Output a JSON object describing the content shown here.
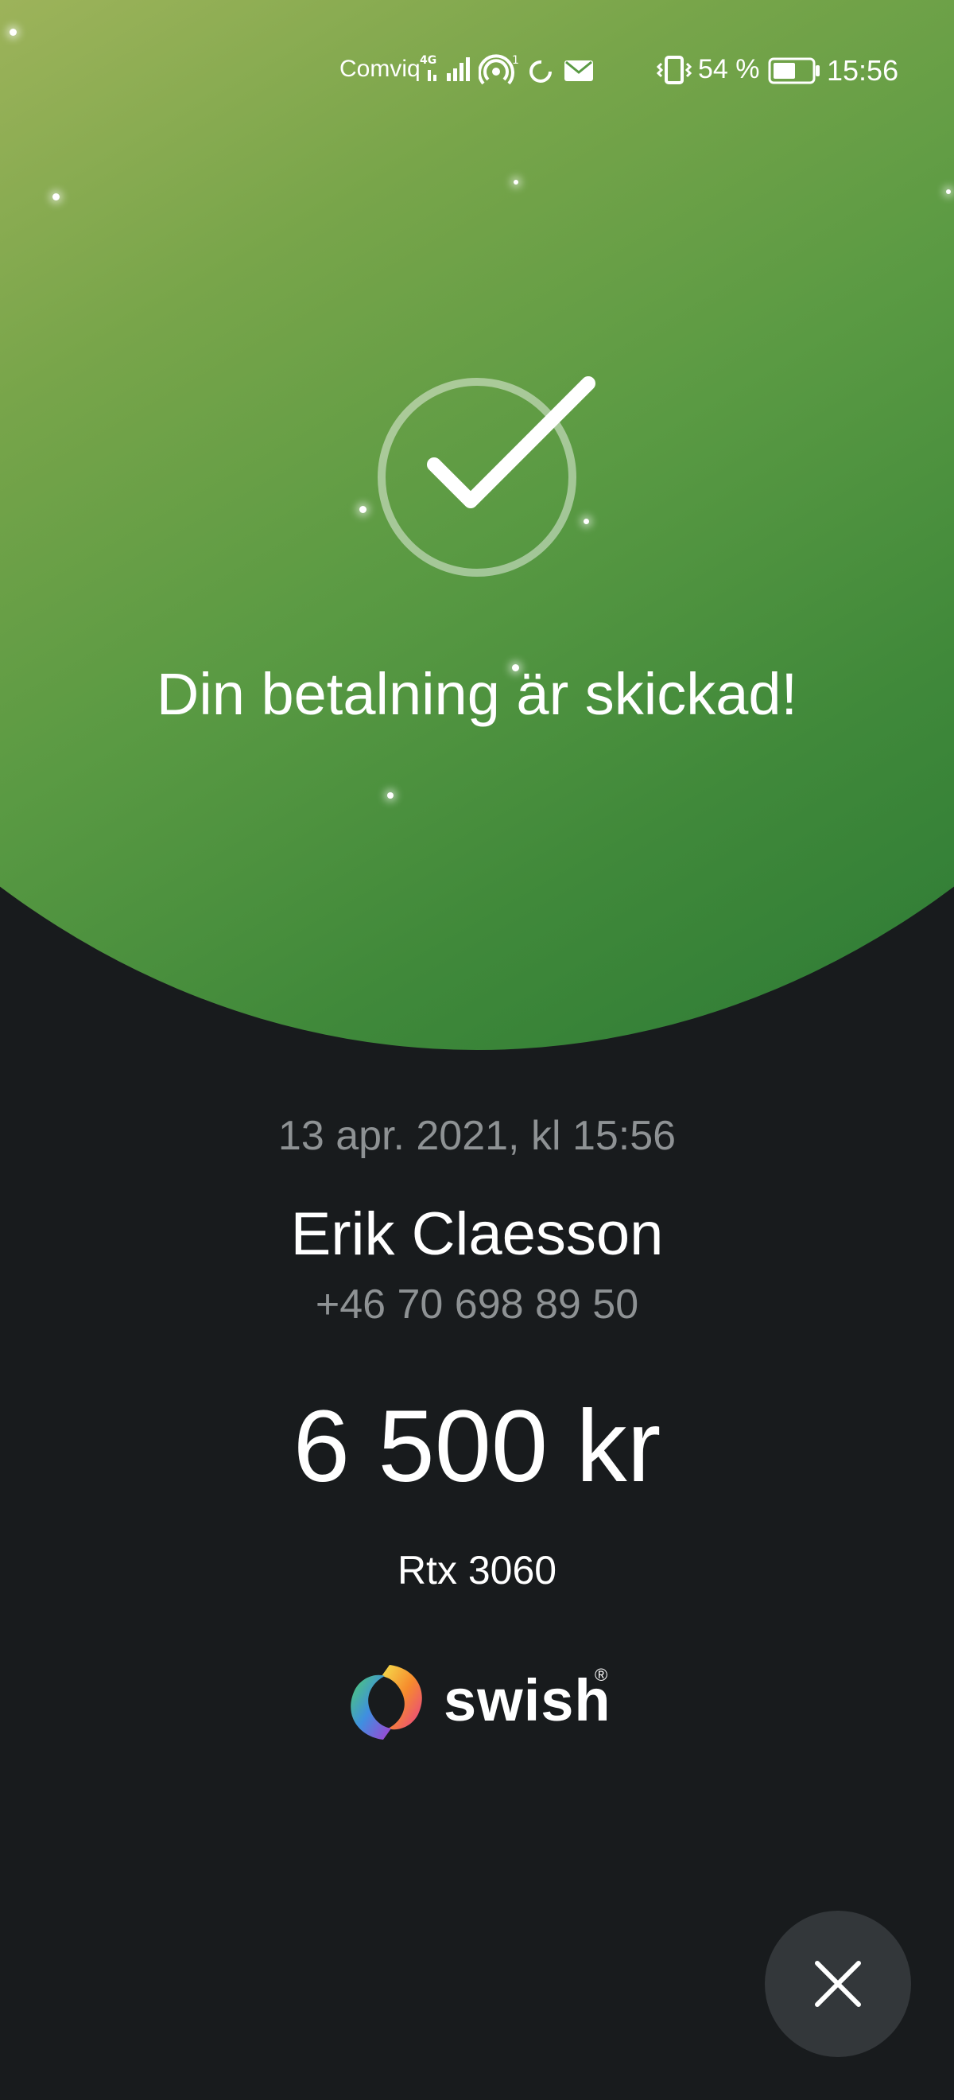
{
  "status_bar": {
    "carrier": "Comviq",
    "network": "4G",
    "battery_percent": "54 %",
    "time": "15:56"
  },
  "confirmation": {
    "headline": "Din betalning är skickad!"
  },
  "payment": {
    "datetime": "13 apr. 2021, kl 15:56",
    "recipient_name": "Erik Claesson",
    "recipient_phone": "+46 70 698 89 50",
    "amount": "6 500 kr",
    "message": "Rtx 3060"
  },
  "brand": {
    "name": "swish",
    "registered_mark": "®"
  },
  "icons": {
    "check": "check-circle-icon",
    "close": "close-icon"
  },
  "colors": {
    "hero_start": "#9db35a",
    "hero_end": "#2c7a35",
    "background": "#181b1d",
    "muted_text": "#8e9294",
    "close_button": "#33373a"
  }
}
